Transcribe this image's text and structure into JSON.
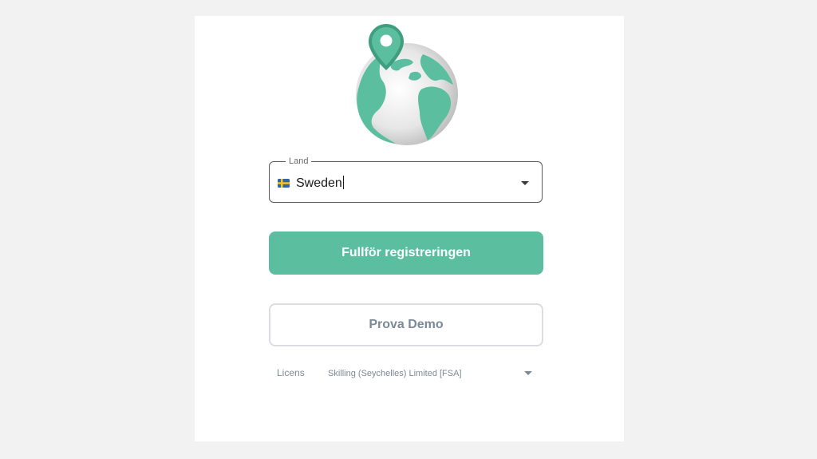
{
  "logo": {
    "icon": "globe-with-location-pin-icon"
  },
  "country_field": {
    "label": "Land",
    "value": "Sweden",
    "flag_icon": "sweden-flag-icon",
    "arrow_icon": "dropdown-arrow-icon"
  },
  "actions": {
    "complete_registration": "Fullför registreringen",
    "try_demo": "Prova Demo"
  },
  "license": {
    "label": "Licens",
    "value": "Skilling (Seychelles) Limited [FSA]",
    "arrow_icon": "dropdown-arrow-icon"
  },
  "colors": {
    "accent": "#5bbf9f",
    "accent_dark": "#3f9e7e",
    "secondary_text": "#7c8a97",
    "background": "#f2f2f2",
    "card": "#ffffff"
  }
}
